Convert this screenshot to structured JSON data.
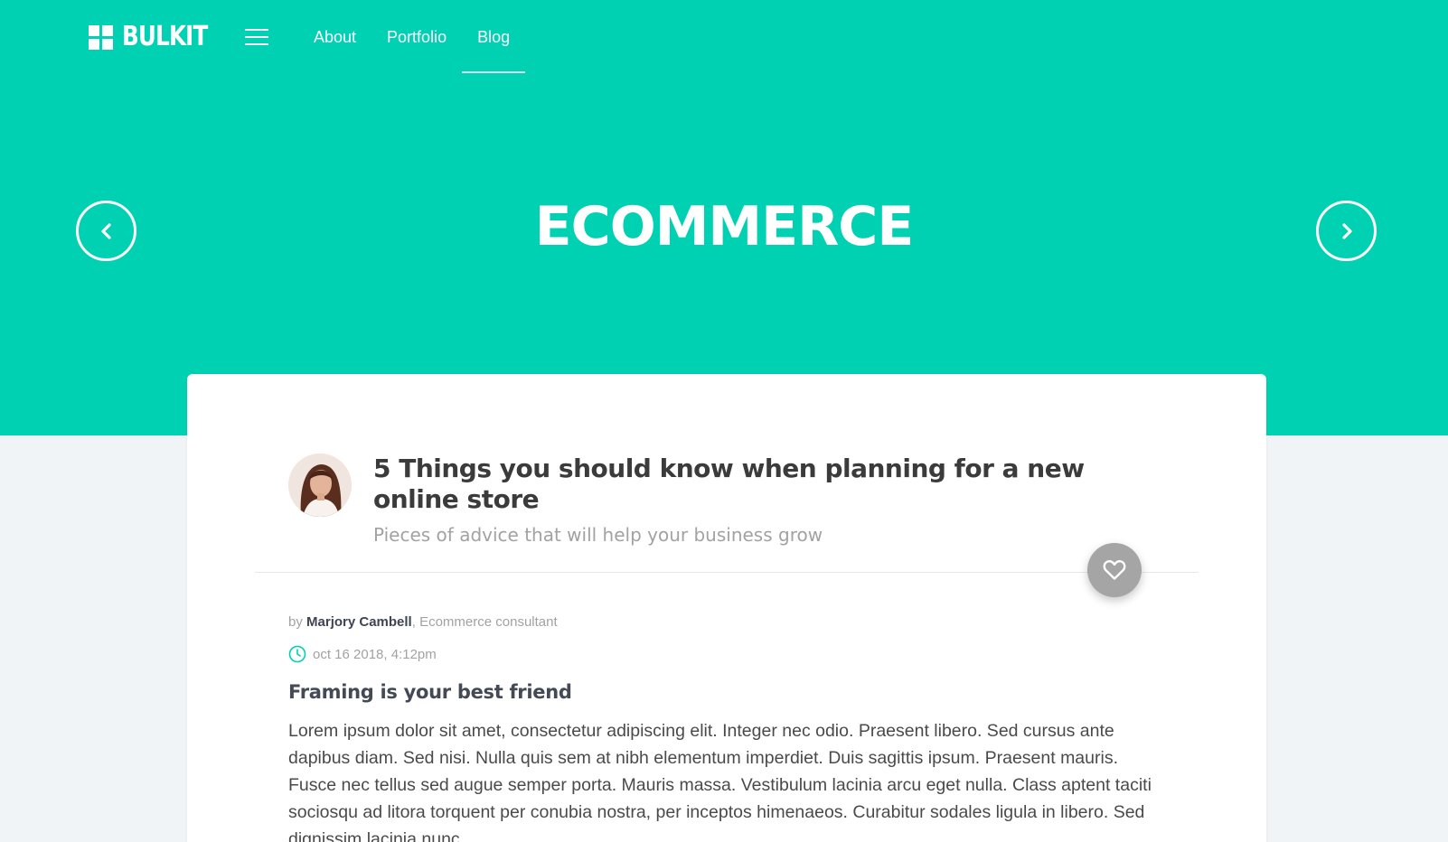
{
  "colors": {
    "accent": "#00d1b2",
    "like_button": "#a5a5a5",
    "background": "#f0f4f6"
  },
  "nav": {
    "brand": "BULKIT",
    "menu_icon": "hamburger-icon",
    "links": [
      "About",
      "Portfolio",
      "Blog"
    ],
    "active": "Blog"
  },
  "hero": {
    "title": "ECOMMERCE",
    "prev_icon": "chevron-left-icon",
    "next_icon": "chevron-right-icon"
  },
  "post": {
    "title": "5 Things you should know when planning for a new online store",
    "subtitle": "Pieces of advice that will help your business grow",
    "by": "by",
    "author": "Marjory Cambell",
    "author_role": ", Ecommerce consultant",
    "date": "oct 16 2018, 4:12pm",
    "section_heading": "Framing is your best friend",
    "body": "Lorem ipsum dolor sit amet, consectetur adipiscing elit. Integer nec odio. Praesent libero. Sed cursus ante dapibus diam. Sed nisi. Nulla quis sem at nibh elementum imperdiet. Duis sagittis ipsum. Praesent mauris. Fusce nec tellus sed augue semper porta. Mauris massa. Vestibulum lacinia arcu eget nulla. Class aptent taciti sociosqu ad litora torquent per conubia nostra, per inceptos himenaeos. Curabitur sodales ligula in libero. Sed dignissim lacinia nunc."
  }
}
